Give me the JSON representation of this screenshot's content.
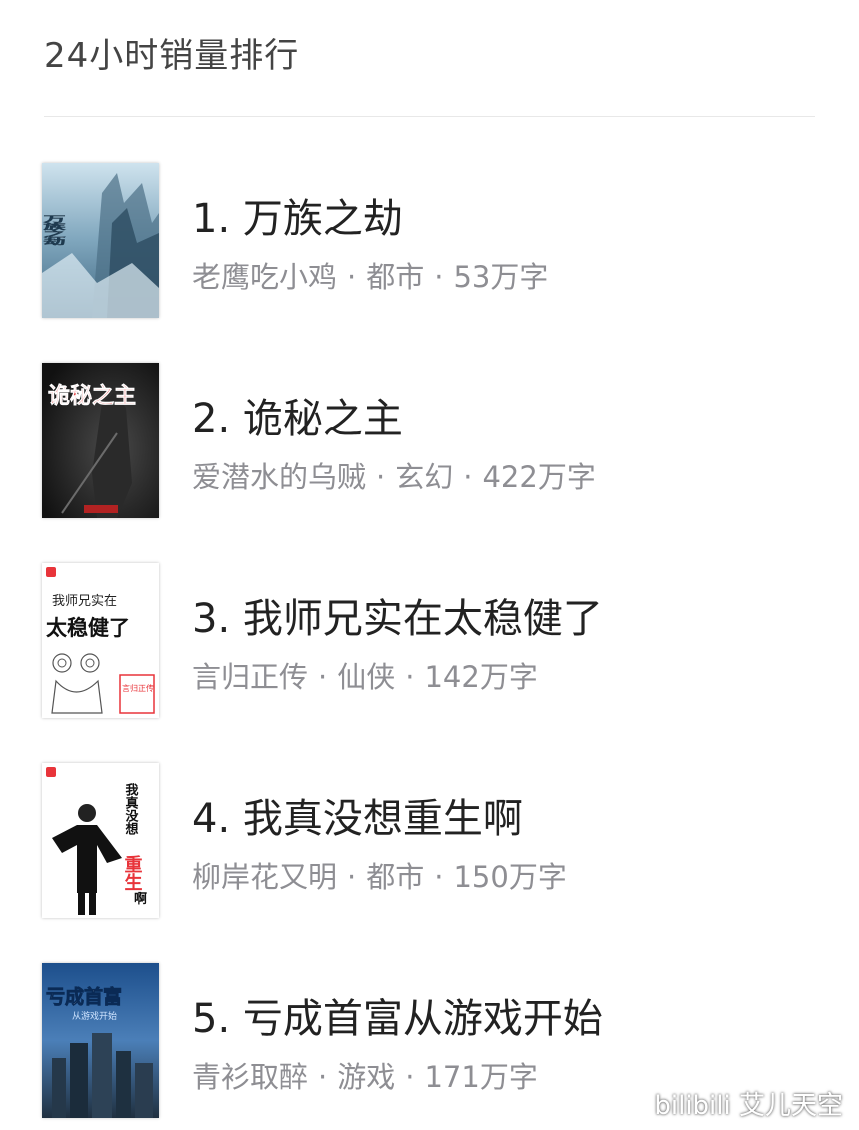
{
  "header": {
    "title": "24小时销量排行"
  },
  "books": [
    {
      "rank": "1.",
      "title": "万族之劫",
      "author": "老鹰吃小鸡",
      "genre": "都市",
      "words": "53万字",
      "cover_text": "万族之劫",
      "cover_theme": "blue-city"
    },
    {
      "rank": "2.",
      "title": "诡秘之主",
      "author": "爱潜水的乌贼",
      "genre": "玄幻",
      "words": "422万字",
      "cover_text": "诡秘之主",
      "cover_theme": "dark-red"
    },
    {
      "rank": "3.",
      "title": "我师兄实在太稳健了",
      "author": "言归正传",
      "genre": "仙侠",
      "words": "142万字",
      "cover_text_top": "我师兄实在",
      "cover_text_main": "太稳健了",
      "cover_badge": "言归正传",
      "cover_theme": "white-sketch"
    },
    {
      "rank": "4.",
      "title": "我真没想重生啊",
      "author": "柳岸花又明",
      "genre": "都市",
      "words": "150万字",
      "cover_text_main": "我真没想",
      "cover_text_red": "重生",
      "cover_text_end": "啊",
      "cover_theme": "white-figure"
    },
    {
      "rank": "5.",
      "title": "亏成首富从游戏开始",
      "author": "青衫取醉",
      "genre": "游戏",
      "words": "171万字",
      "cover_text": "亏成首富",
      "cover_subtext": "从游戏开始",
      "cover_theme": "blue-skyline"
    }
  ],
  "separator": "·",
  "watermark": "bilibili 艾儿天空",
  "colors": {
    "title": "#222222",
    "meta": "#8e8e93",
    "divider": "#e8e8e8",
    "brand_red": "#e8343a"
  }
}
